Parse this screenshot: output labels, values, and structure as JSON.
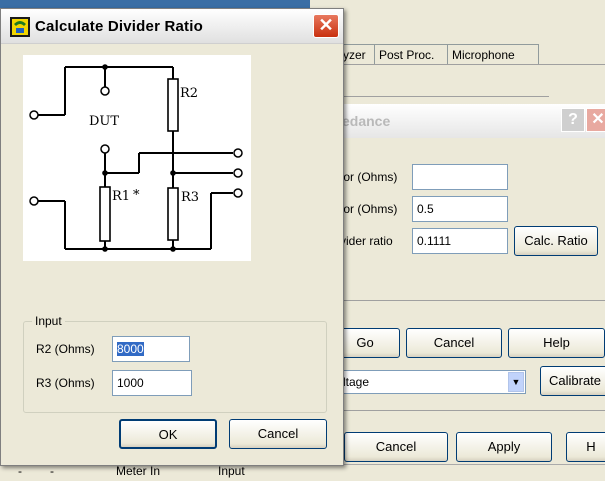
{
  "background_app": {
    "tabs": [
      "yzer",
      "Post Proc.",
      "Microphone"
    ],
    "inner_dialog_title": "edance",
    "help_glyph": "?",
    "close_glyph": "✕",
    "labels": {
      "motor_ohms_1": "tor (Ohms)",
      "motor_ohms_2": "tor (Ohms)",
      "divider_ratio": "vider ratio"
    },
    "fields": {
      "field1": "",
      "field2": "0.5",
      "divider_ratio": "0.1111"
    },
    "buttons": {
      "calc_ratio": "Calc. Ratio",
      "go": "Go",
      "cancel": "Cancel",
      "help": "Help",
      "calibrate": "Calibrate",
      "cancel2": "Cancel",
      "apply": "Apply",
      "h": "H"
    },
    "combo_value": "ltage",
    "status": {
      "left1": "-",
      "left2": "-",
      "item1": "Meter In",
      "item2": "Input"
    }
  },
  "dialog": {
    "title": "Calculate Divider Ratio",
    "close_glyph": "✕",
    "schematic": {
      "labels": {
        "r2": "R2",
        "dut": "DUT",
        "r1": "R1",
        "r1_star": "*",
        "r3": "R3"
      }
    },
    "input_group": {
      "legend": "Input",
      "r2_label": "R2 (Ohms)",
      "r2_value": "8000",
      "r3_label": "R3 (Ohms)",
      "r3_value": "1000"
    },
    "buttons": {
      "ok": "OK",
      "cancel": "Cancel"
    }
  },
  "colors": {
    "desktop": "#3a6ea5",
    "dialog_bg": "#ece9d8",
    "close_red": "#c9300f",
    "selection": "#316ac5"
  }
}
